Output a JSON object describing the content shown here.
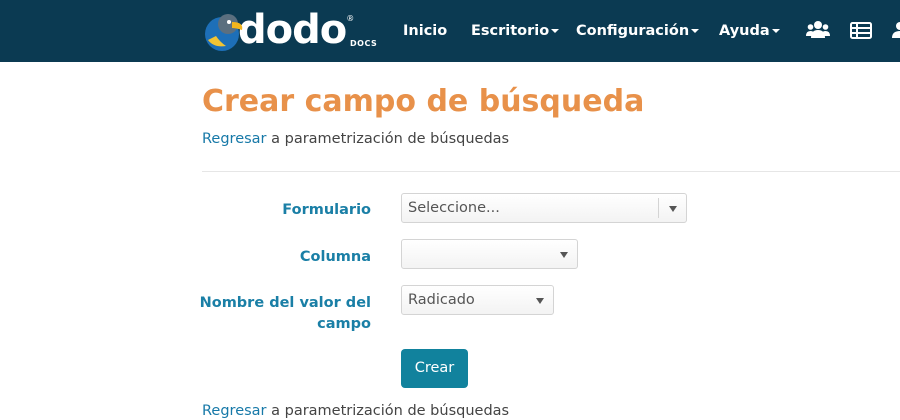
{
  "nav": {
    "brand": "dodo",
    "brand_reg": "®",
    "brand_sub": "DOCS",
    "items": [
      "Inicio",
      "Escritorio",
      "Configuración",
      "Ayuda"
    ],
    "icons": [
      "users-icon",
      "table-icon",
      "user-icon"
    ]
  },
  "page": {
    "title": "Crear campo de búsqueda",
    "back_link": "Regresar",
    "back_text": " a parametrización de búsquedas"
  },
  "form": {
    "formulario_label": "Formulario",
    "formulario_value": "Seleccione...",
    "columna_label": "Columna",
    "columna_value": "",
    "nombre_label_1": "Nombre del valor del",
    "nombre_label_2": "campo",
    "nombre_value": "Radicado",
    "submit": "Crear"
  },
  "colors": {
    "navbar": "#0b3a52",
    "title": "#e8914a",
    "link": "#1779a8",
    "label": "#1a7fa6",
    "button": "#11829d"
  }
}
